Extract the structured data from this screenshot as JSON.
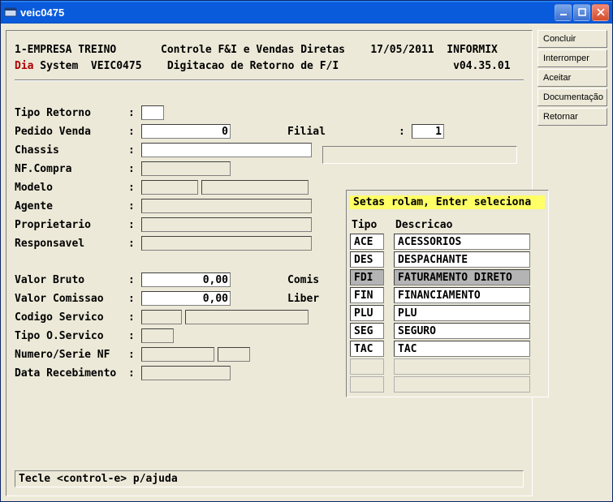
{
  "window": {
    "title": "veic0475"
  },
  "side_buttons": [
    "Concluir",
    "Interromper",
    "Aceitar",
    "Documentação",
    "Retornar"
  ],
  "header": {
    "line1_left": "1-EMPRESA TREINO",
    "line1_mid": "Controle F&I e Vendas Diretas",
    "line1_date": "17/05/2011",
    "line1_db": "INFORMIX",
    "line2_dia": "Dia",
    "line2_sys": " System  VEIC0475",
    "line2_mid": "Digitacao de Retorno de F/I",
    "line2_ver": "v04.35.01"
  },
  "form": {
    "tipo_retorno": {
      "label": "Tipo Retorno",
      "value": ""
    },
    "pedido_venda": {
      "label": "Pedido Venda",
      "value": "0"
    },
    "filial": {
      "label": "Filial",
      "value": "1"
    },
    "chassis": {
      "label": "Chassis",
      "value": ""
    },
    "nf_compra": {
      "label": "NF.Compra",
      "value": ""
    },
    "modelo": {
      "label": "Modelo",
      "value": ""
    },
    "agente": {
      "label": "Agente",
      "value": ""
    },
    "proprietario": {
      "label": "Proprietario",
      "value": ""
    },
    "responsavel": {
      "label": "Responsavel",
      "value": ""
    },
    "valor_bruto": {
      "label": "Valor Bruto",
      "value": "0,00"
    },
    "comis": {
      "label": "Comis"
    },
    "valor_comissao": {
      "label": "Valor Comissao",
      "value": "0,00"
    },
    "liber": {
      "label": "Liber"
    },
    "codigo_servico": {
      "label": "Codigo Servico",
      "value": ""
    },
    "tipo_oservico": {
      "label": "Tipo O.Servico",
      "value": ""
    },
    "numero_serie_nf": {
      "label": "Numero/Serie NF",
      "value": ""
    },
    "data_recebimento": {
      "label": "Data Recebimento",
      "value": ""
    }
  },
  "popup": {
    "hint": "Setas rolam, Enter seleciona",
    "col_tipo": "Tipo",
    "col_desc": "Descricao",
    "selected_index": 2,
    "rows": [
      {
        "tipo": "ACE",
        "desc": "ACESSORIOS"
      },
      {
        "tipo": "DES",
        "desc": "DESPACHANTE"
      },
      {
        "tipo": "FDI",
        "desc": "FATURAMENTO DIRETO"
      },
      {
        "tipo": "FIN",
        "desc": "FINANCIAMENTO"
      },
      {
        "tipo": "PLU",
        "desc": "PLU"
      },
      {
        "tipo": "SEG",
        "desc": "SEGURO"
      },
      {
        "tipo": "TAC",
        "desc": "TAC"
      },
      {
        "tipo": "",
        "desc": ""
      },
      {
        "tipo": "",
        "desc": ""
      }
    ]
  },
  "status": "Tecle <control-e> p/ajuda"
}
